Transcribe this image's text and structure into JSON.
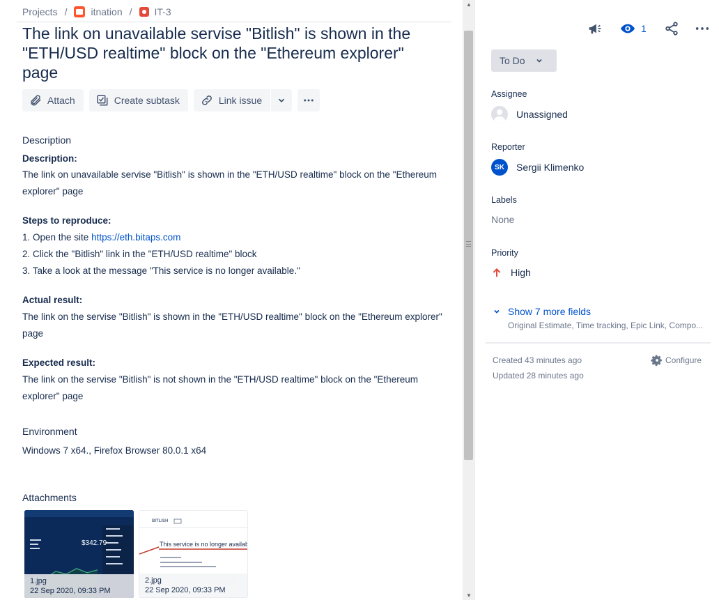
{
  "breadcrumb": {
    "projects": "Projects",
    "project": "itnation",
    "issue_key": "IT-3"
  },
  "issue": {
    "title": "The link on unavailable servise \"Bitlish\" is shown in the \"ETH/USD realtime\" block on the \"Ethereum explorer\" page"
  },
  "toolbar": {
    "attach": "Attach",
    "create_subtask": "Create subtask",
    "link_issue": "Link issue"
  },
  "description": {
    "section_label": "Description",
    "desc_heading": "Description:",
    "desc_text": "The link on unavailable servise \"Bitlish\" is shown in the \"ETH/USD realtime\" block on the \"Ethereum explorer\" page",
    "steps_heading": "Steps to reproduce:",
    "step1_prefix": "1. Open the site ",
    "step1_link": "https://eth.bitaps.com",
    "step2": "2. Click the \"Bitlish\" link in the \"ETH/USD realtime\" block",
    "step3": "3. Take a look at the message \"This service is no longer available.\"",
    "actual_heading": "Actual result:",
    "actual_text": "The link on the servise \"Bitlish\" is shown in the \"ETH/USD realtime\" block on the \"Ethereum explorer\" page",
    "expected_heading": "Expected result:",
    "expected_text": "The link on the servise \"Bitlish\" is not shown in the \"ETH/USD realtime\" block on the \"Ethereum explorer\" page"
  },
  "environment": {
    "label": "Environment",
    "value": "Windows 7 x64., Firefox Browser 80.0.1 x64"
  },
  "attachments": {
    "label": "Attachments",
    "items": [
      {
        "name": "1.jpg",
        "date": "22 Sep 2020, 09:33 PM",
        "preview_price": "$342.79"
      },
      {
        "name": "2.jpg",
        "date": "22 Sep 2020, 09:33 PM",
        "preview_brand": "BITLISH",
        "preview_message": "This service is no longer available."
      }
    ]
  },
  "sidebar": {
    "watchers_count": "1",
    "status": "To Do",
    "assignee_label": "Assignee",
    "assignee_value": "Unassigned",
    "reporter_label": "Reporter",
    "reporter_initials": "SK",
    "reporter_value": "Sergii Klimenko",
    "labels_label": "Labels",
    "labels_value": "None",
    "priority_label": "Priority",
    "priority_value": "High",
    "show_more": "Show 7 more fields",
    "more_fields_list": "Original Estimate, Time tracking, Epic Link, Compo...",
    "created": "Created 43 minutes ago",
    "updated": "Updated 28 minutes ago",
    "configure": "Configure"
  },
  "colors": {
    "link": "#0052cc",
    "priority_high": "#e5493a",
    "avatar": "#0052cc"
  }
}
